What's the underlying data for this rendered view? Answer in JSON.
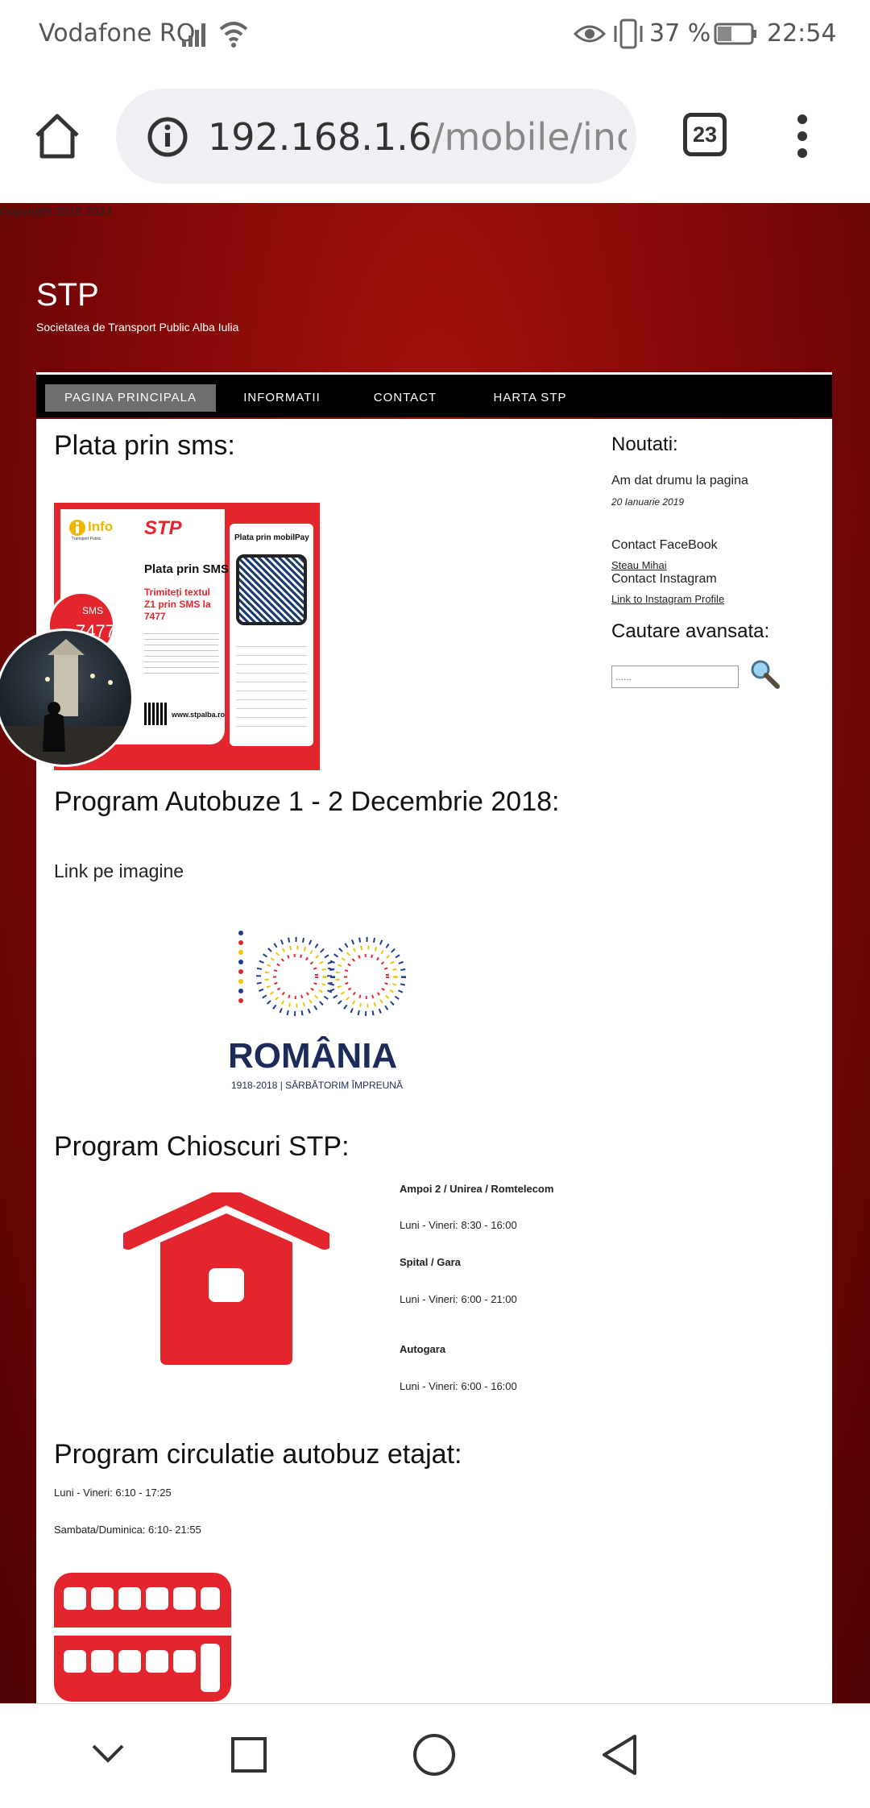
{
  "status_bar": {
    "carrier": "Vodafone RO",
    "battery_percent": "37 %",
    "time": "22:54",
    "icons": [
      "signal-icon",
      "wifi-icon",
      "eye-comfort-icon",
      "vibrate-icon",
      "battery-icon"
    ]
  },
  "browser": {
    "url_host": "192.168.1.6",
    "url_path": "/mobile/ind",
    "tab_count": "23",
    "icons": [
      "home-icon",
      "info-icon",
      "tabs-icon",
      "menu-icon"
    ]
  },
  "page": {
    "top_note": "Copyright 2019 2023",
    "site_title": "STP",
    "site_subtitle": "Societatea de Transport Public Alba Iulia",
    "nav": [
      {
        "label": "PAGINA PRINCIPALA",
        "active": true
      },
      {
        "label": "INFORMATII",
        "active": false
      },
      {
        "label": "CONTACT",
        "active": false
      },
      {
        "label": "HARTA STP",
        "active": false
      }
    ],
    "main": {
      "sms_heading": "Plata prin sms:",
      "sms_image": {
        "brand_info": "Info",
        "brand_info_sub": "Transport Public",
        "brand_stp": "STP",
        "title": "Plata prin SMS",
        "instruction": "Trimiteți textul Z1 prin SMS la 7477",
        "sms_label": "SMS",
        "sms_number": "7477",
        "mobilpay_title": "Plata prin mobilPay",
        "website": "www.stpalba.ro"
      },
      "program_heading": "Program Autobuze 1 - 2 Decembrie 2018:",
      "link_text": "Link pe imagine",
      "romania_image": {
        "number": "100",
        "word": "ROMÂNIA",
        "tagline": "1918-2018 | SĂRBĂTORIM ÎMPREUNĂ"
      },
      "kiosk_heading": "Program Chioscuri STP:",
      "kiosks": [
        {
          "name": "Ampoi 2 / Unirea / Romtelecom",
          "hours": "Luni - Vineri: 8:30 - 16:00"
        },
        {
          "name": "Spital / Gara",
          "hours": "Luni - Vineri: 6:00 - 21:00"
        },
        {
          "name": "Autogara",
          "hours": "Luni - Vineri: 6:00 - 16:00"
        }
      ],
      "bus_heading": "Program circulatie autobuz etajat:",
      "bus_hours": [
        "Luni - Vineri: 6:10 - 17:25",
        "Sambata/Duminica: 6:10- 21:55"
      ]
    },
    "sidebar": {
      "news_title": "Noutati:",
      "news_item": "Am dat drumu la pagina",
      "news_date": "20 Ianuarie 2019",
      "contact_fb_label": "Contact FaceBook",
      "contact_fb_link": "Steau Mihai",
      "contact_ig_label": "Contact Instagram",
      "contact_ig_link": "Link to Instagram Profile",
      "search_title": "Cautare avansata:",
      "search_placeholder": "......"
    }
  },
  "colors": {
    "brand_red": "#e3262e",
    "page_background": "#7c0706",
    "nav_background": "#000000",
    "nav_active": "#6e6e6e"
  },
  "system_nav": [
    "collapse-icon",
    "recents-icon",
    "home-circle-icon",
    "back-icon"
  ]
}
